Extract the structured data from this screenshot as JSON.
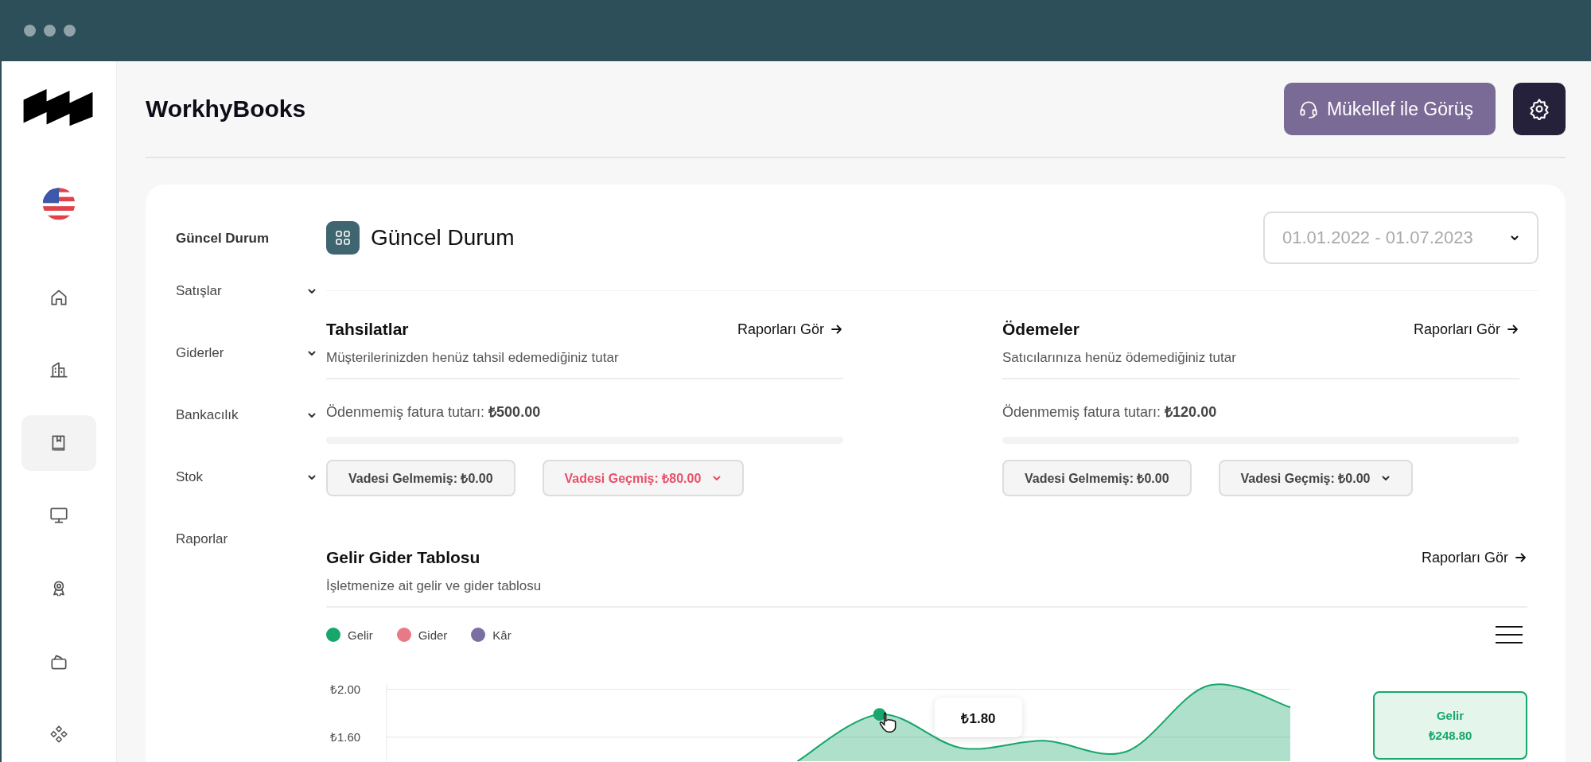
{
  "app": {
    "title": "WorkhyBooks"
  },
  "rail": [
    {
      "selected": false
    },
    {
      "selected": false
    },
    {
      "selected": true
    },
    {
      "selected": false
    },
    {
      "selected": false
    },
    {
      "selected": false
    },
    {
      "selected": false
    }
  ],
  "header_buttons": {
    "meet": "Mükellef ile Görüş"
  },
  "nav": [
    {
      "label": "Güncel Durum",
      "kind": "link",
      "selected": true
    },
    {
      "label": "Satışlar",
      "kind": "group",
      "selected": false
    },
    {
      "label": "Giderler",
      "kind": "group",
      "selected": false
    },
    {
      "label": "Bankacılık",
      "kind": "group",
      "selected": false
    },
    {
      "label": "Stok",
      "kind": "group",
      "selected": false
    },
    {
      "label": "Raporlar",
      "kind": "link",
      "selected": false
    }
  ],
  "page": {
    "title": "Güncel Durum",
    "date_range": "01.01.2022 - 01.07.2023"
  },
  "sections": [
    {
      "title": "Tahsilatlar",
      "link": "Raporları Gör",
      "subtitle": "Müşterilerinizden henüz tahsil edemediğiniz tutar",
      "amount": "Ödenmemiş fatura tutarı: **₺500.00**",
      "level": 0,
      "pills": [
        {
          "label": "Vadesi Gelmemiş: ₺0.00",
          "alert": false,
          "dropdown": false
        },
        {
          "label": "Vadesi Geçmiş: ₺80.00",
          "alert": true,
          "dropdown": true
        }
      ]
    },
    {
      "title": "Ödemeler",
      "link": "Raporları Gör",
      "subtitle": "Satıcılarınıza henüz ödemediğiniz tutar",
      "amount": "Ödenmemiş fatura tutarı: **₺120.00**",
      "level": 0,
      "pills": [
        {
          "label": "Vadesi Gelmemiş: ₺0.00",
          "alert": false,
          "dropdown": false
        },
        {
          "label": "Vadesi Geçmiş: ₺0.00",
          "alert": false,
          "dropdown": true
        }
      ]
    }
  ],
  "chart_section": {
    "title": "Gelir Gider Tablosu",
    "link": "Raporları Gör",
    "subtitle": "İşletmenize ait gelir ve gider tablosu",
    "tooltip": "₺1.80",
    "summary": {
      "label": "Gelir",
      "value": "₺248.80"
    },
    "chart_data": {
      "type": "area",
      "ylim": [
        1.4,
        2.05
      ],
      "yticks": [
        {
          "value": 1.6,
          "label": "₺1.60"
        },
        {
          "value": 2.0,
          "label": "₺2.00"
        }
      ],
      "series": [
        {
          "name": "Gelir",
          "color": "#17a66b",
          "values": [
            null,
            null,
            null,
            null,
            null,
            1.4,
            1.79,
            1.51,
            1.57,
            1.48,
            2.03,
            1.85
          ]
        },
        {
          "name": "Gider",
          "color": "#e87a86",
          "values": [
            null,
            null,
            null,
            null,
            null,
            null,
            null,
            null,
            null,
            null,
            null,
            null
          ]
        },
        {
          "name": "Kâr",
          "color": "#7a6ea3",
          "values": [
            null,
            null,
            null,
            null,
            null,
            null,
            null,
            null,
            null,
            null,
            null,
            null
          ]
        }
      ]
    }
  }
}
